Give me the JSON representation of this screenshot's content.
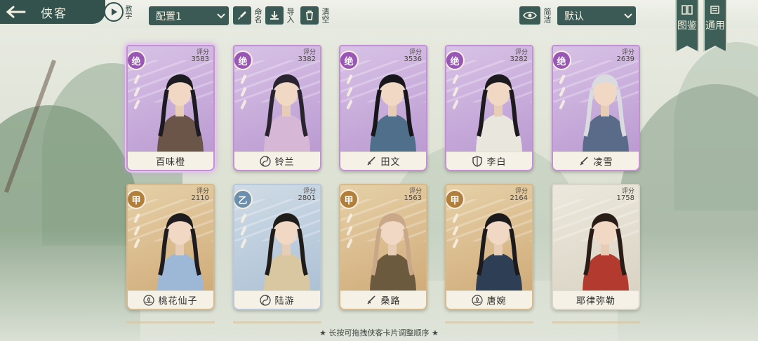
{
  "header": {
    "title": "侠客",
    "tutorial_label": "教学",
    "config_select": "配置1",
    "rename_label": "命名",
    "import_label": "导入",
    "clear_label": "清空",
    "simple_label": "简洁",
    "sort_select": "默认"
  },
  "side_tabs": [
    {
      "label": "图鉴"
    },
    {
      "label": "通用"
    }
  ],
  "cards": [
    {
      "name": "百味橙",
      "grade": "绝",
      "score_label": "评分",
      "score": "3583",
      "rarity": "jue",
      "sect_icon": "none",
      "selected": true
    },
    {
      "name": "铃兰",
      "grade": "绝",
      "score_label": "评分",
      "score": "3382",
      "rarity": "jue",
      "sect_icon": "taiji-icon"
    },
    {
      "name": "田文",
      "grade": "绝",
      "score_label": "评分",
      "score": "3536",
      "rarity": "jue",
      "sect_icon": "sword-icon"
    },
    {
      "name": "李白",
      "grade": "绝",
      "score_label": "评分",
      "score": "3282",
      "rarity": "jue",
      "sect_icon": "shield-icon"
    },
    {
      "name": "凌雪",
      "grade": "绝",
      "score_label": "评分",
      "score": "2639",
      "rarity": "jue",
      "sect_icon": "sword-icon"
    },
    {
      "name": "桃花仙子",
      "grade": "甲",
      "score_label": "评分",
      "score": "2110",
      "rarity": "jia",
      "sect_icon": "lotus-icon"
    },
    {
      "name": "陆游",
      "grade": "乙",
      "score_label": "评分",
      "score": "2801",
      "rarity": "yi",
      "sect_icon": "taiji-icon"
    },
    {
      "name": "桑路",
      "grade": "甲",
      "score_label": "评分",
      "score": "1563",
      "rarity": "jia",
      "sect_icon": "sword-icon"
    },
    {
      "name": "唐婉",
      "grade": "甲",
      "score_label": "评分",
      "score": "2164",
      "rarity": "jia",
      "sect_icon": "lotus-icon"
    },
    {
      "name": "耶律弥勒",
      "grade": "",
      "score_label": "评分",
      "score": "1758",
      "rarity": "none",
      "sect_icon": "none"
    }
  ],
  "footer": {
    "hint": "★ 长按可拖拽侠客卡片调整顺序 ★"
  },
  "colors": {
    "jue": "#b796cf",
    "jia": "#cda774",
    "yi": "#a9bed3",
    "ui_dark": "#33514d"
  }
}
